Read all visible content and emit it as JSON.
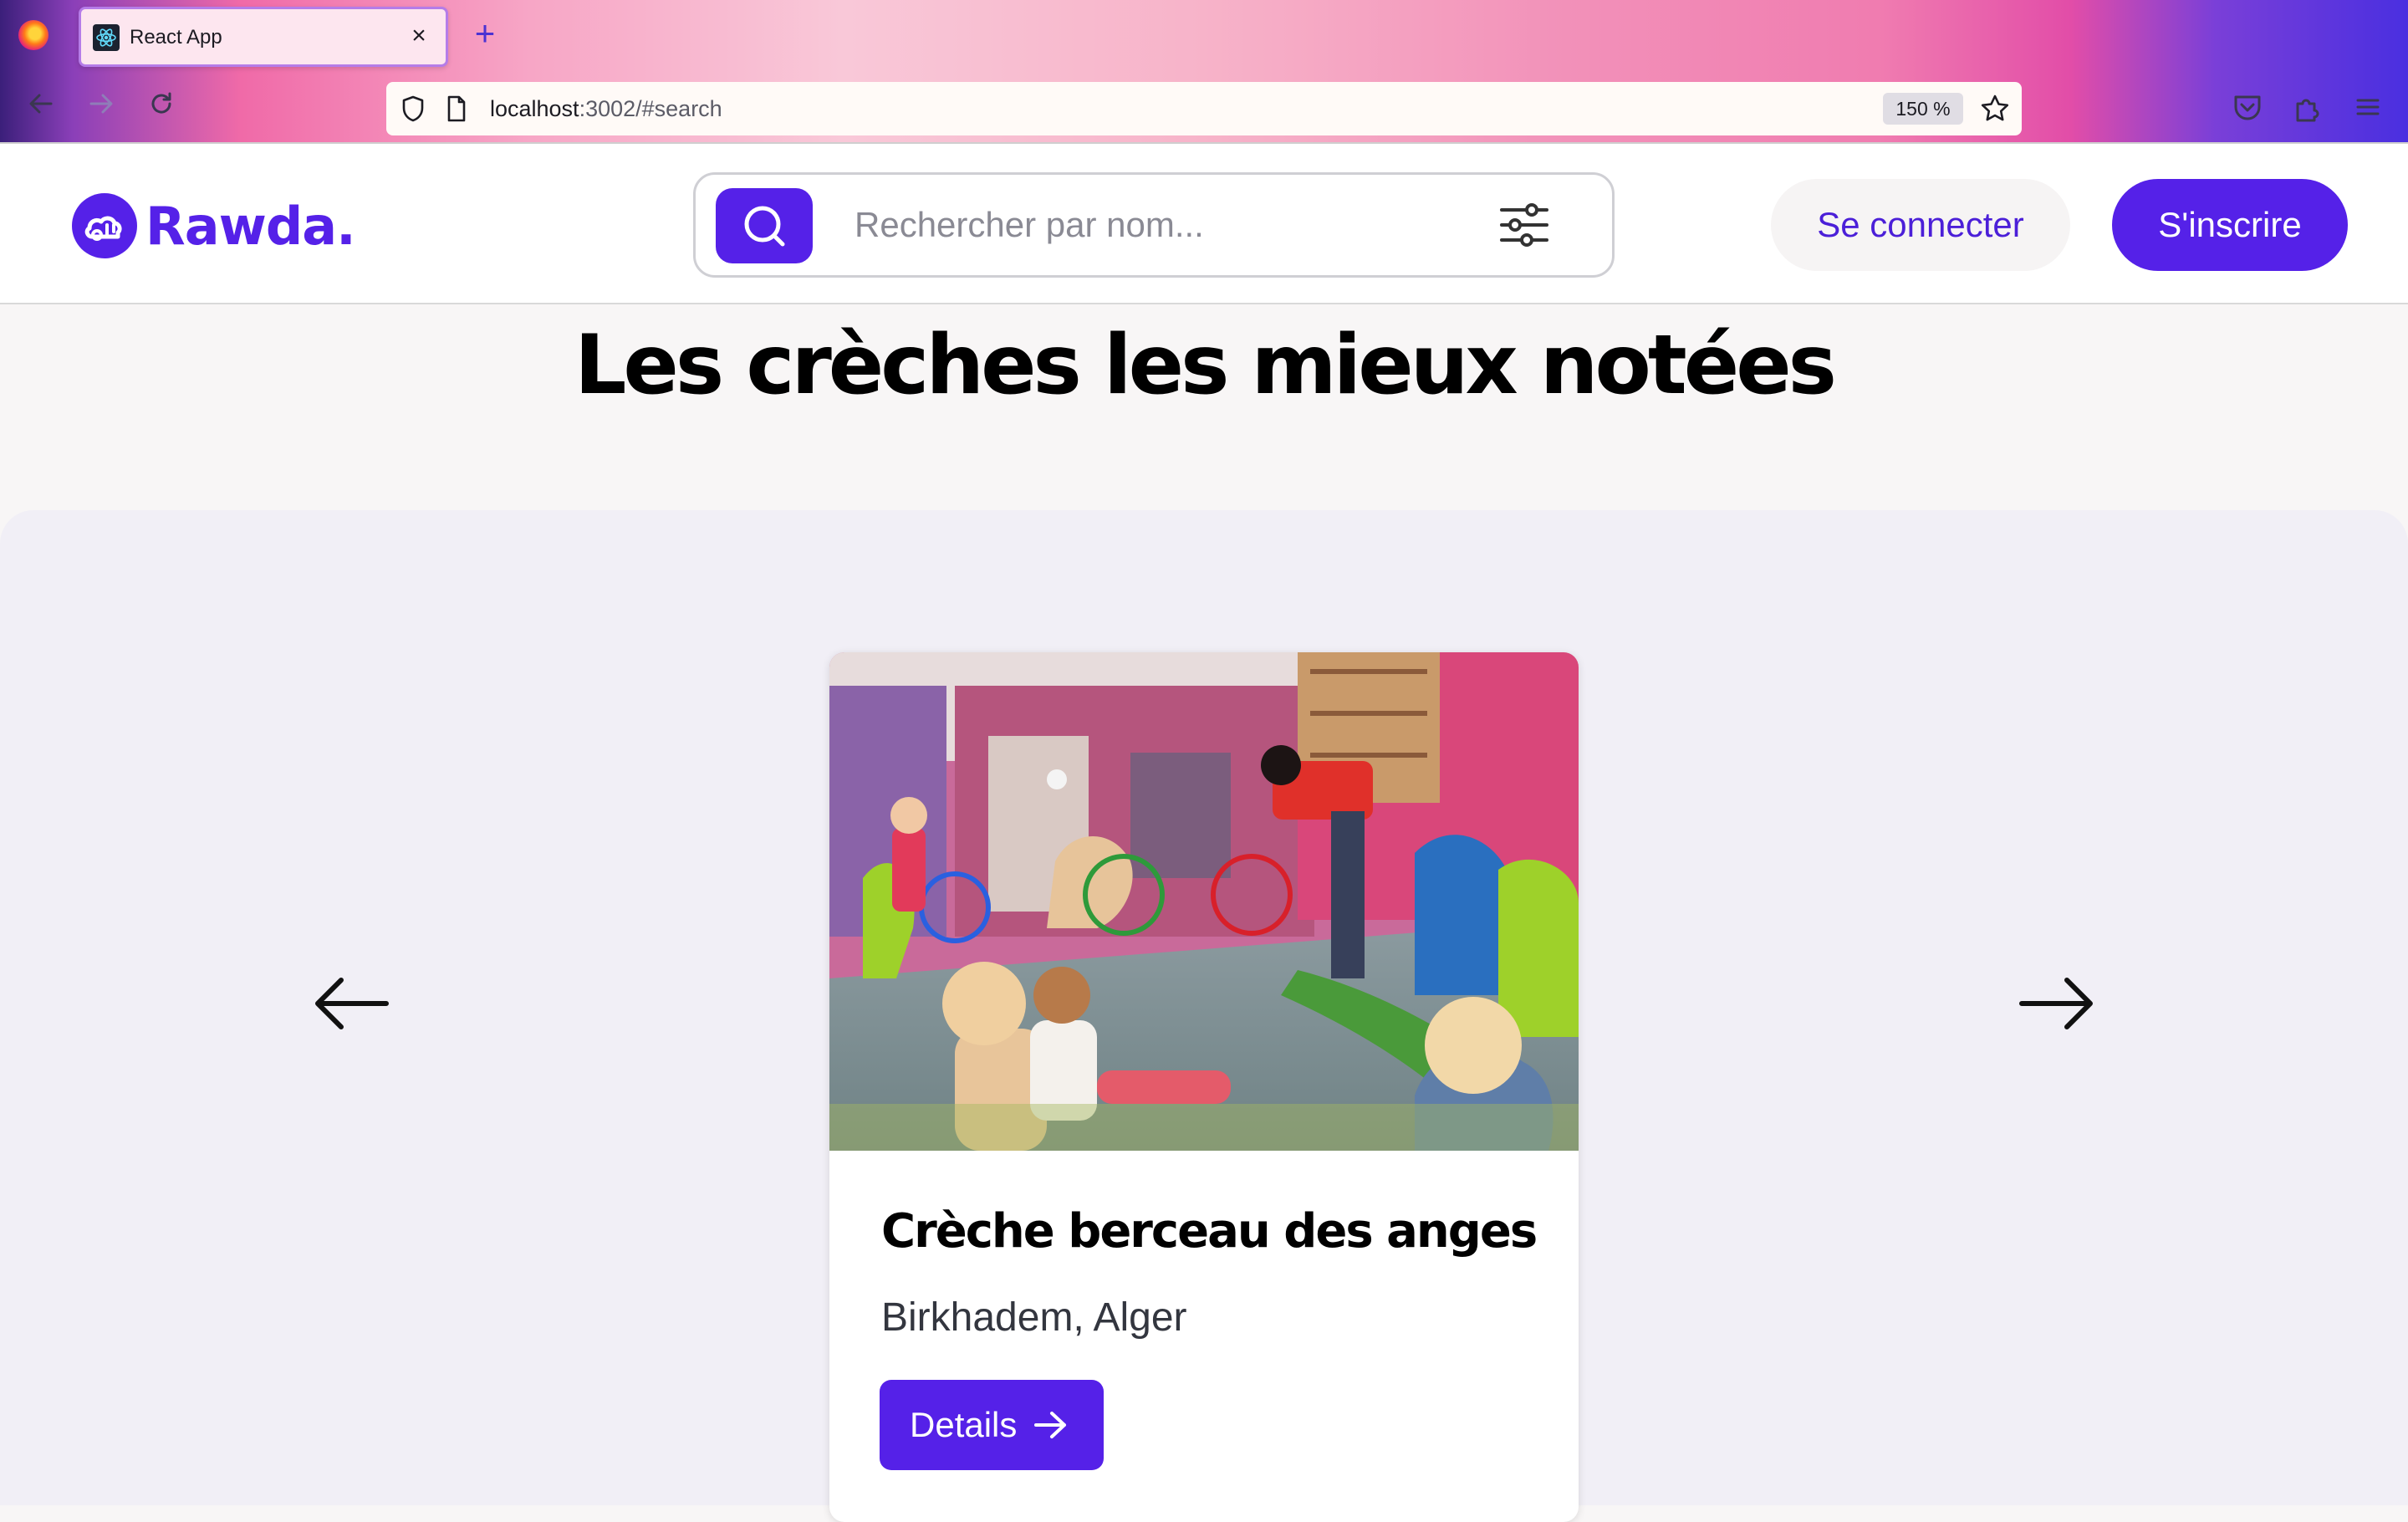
{
  "browser": {
    "tab_title": "React App",
    "url_host": "localhost",
    "url_rest": ":3002/#search",
    "zoom": "150 %"
  },
  "header": {
    "logo_text": "Rawda.",
    "search_placeholder": "Rechercher par nom...",
    "login_label": "Se connecter",
    "signup_label": "S'inscrire"
  },
  "section": {
    "title": "Les crèches les mieux notées"
  },
  "card": {
    "name": "Crèche berceau des anges",
    "location": "Birkhadem, Alger",
    "button_label": "Details"
  },
  "colors": {
    "brand": "#5521e8",
    "highlight": "#f8f32b"
  }
}
